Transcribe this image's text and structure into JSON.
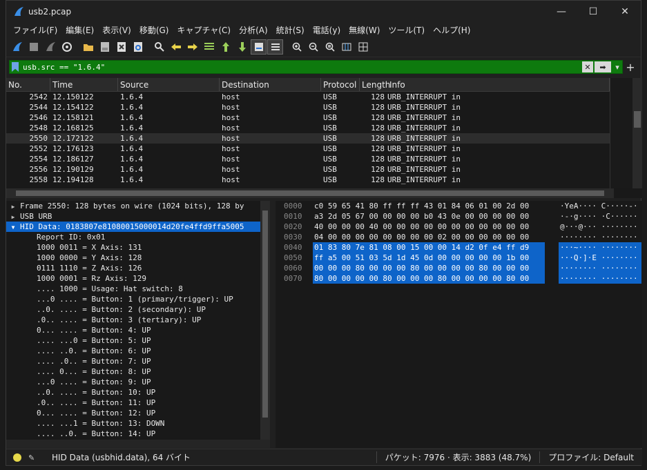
{
  "window": {
    "title": "usb2.pcap",
    "minimize": "—",
    "maximize": "☐",
    "close": "✕"
  },
  "menu": [
    "ファイル(F)",
    "編集(E)",
    "表示(V)",
    "移動(G)",
    "キャプチャ(C)",
    "分析(A)",
    "統計(S)",
    "電話(y)",
    "無線(W)",
    "ツール(T)",
    "ヘルプ(H)"
  ],
  "filter": {
    "value": "usb.src == \"1.6.4\"",
    "clear_icon": "✕",
    "apply_icon": "➡",
    "dropdown": "▾",
    "add": "+"
  },
  "columns": [
    "No.",
    "Time",
    "Source",
    "Destination",
    "Protocol",
    "Length",
    "Info"
  ],
  "packets": [
    {
      "no": "2542",
      "time": "12.150122",
      "src": "1.6.4",
      "dst": "host",
      "proto": "USB",
      "len": "128",
      "info": "URB_INTERRUPT in"
    },
    {
      "no": "2544",
      "time": "12.154122",
      "src": "1.6.4",
      "dst": "host",
      "proto": "USB",
      "len": "128",
      "info": "URB_INTERRUPT in"
    },
    {
      "no": "2546",
      "time": "12.158121",
      "src": "1.6.4",
      "dst": "host",
      "proto": "USB",
      "len": "128",
      "info": "URB_INTERRUPT in"
    },
    {
      "no": "2548",
      "time": "12.168125",
      "src": "1.6.4",
      "dst": "host",
      "proto": "USB",
      "len": "128",
      "info": "URB_INTERRUPT in"
    },
    {
      "no": "2550",
      "time": "12.172122",
      "src": "1.6.4",
      "dst": "host",
      "proto": "USB",
      "len": "128",
      "info": "URB_INTERRUPT in"
    },
    {
      "no": "2552",
      "time": "12.176123",
      "src": "1.6.4",
      "dst": "host",
      "proto": "USB",
      "len": "128",
      "info": "URB_INTERRUPT in"
    },
    {
      "no": "2554",
      "time": "12.186127",
      "src": "1.6.4",
      "dst": "host",
      "proto": "USB",
      "len": "128",
      "info": "URB_INTERRUPT in"
    },
    {
      "no": "2556",
      "time": "12.190129",
      "src": "1.6.4",
      "dst": "host",
      "proto": "USB",
      "len": "128",
      "info": "URB_INTERRUPT in"
    },
    {
      "no": "2558",
      "time": "12.194128",
      "src": "1.6.4",
      "dst": "host",
      "proto": "USB",
      "len": "128",
      "info": "URB_INTERRUPT in"
    }
  ],
  "details": [
    {
      "tw": "▶",
      "indent": 0,
      "text": "Frame 2550: 128 bytes on wire (1024 bits), 128 by"
    },
    {
      "tw": "▶",
      "indent": 0,
      "text": "USB URB"
    },
    {
      "tw": "▼",
      "indent": 0,
      "text": "HID Data: 0183807e81080015000014d20fe4ffd9ffa5005"
    },
    {
      "tw": "",
      "indent": 1,
      "text": "Report ID: 0x01"
    },
    {
      "tw": "",
      "indent": 1,
      "text": "1000 0011 = X Axis: 131"
    },
    {
      "tw": "",
      "indent": 1,
      "text": "1000 0000 = Y Axis: 128"
    },
    {
      "tw": "",
      "indent": 1,
      "text": "0111 1110 = Z Axis: 126"
    },
    {
      "tw": "",
      "indent": 1,
      "text": "1000 0001 = Rz Axis: 129"
    },
    {
      "tw": "",
      "indent": 1,
      "text": ".... 1000 = Usage: Hat switch: 8"
    },
    {
      "tw": "",
      "indent": 1,
      "text": "...0 .... = Button: 1 (primary/trigger): UP"
    },
    {
      "tw": "",
      "indent": 1,
      "text": "..0. .... = Button: 2 (secondary): UP"
    },
    {
      "tw": "",
      "indent": 1,
      "text": ".0.. .... = Button: 3 (tertiary): UP"
    },
    {
      "tw": "",
      "indent": 1,
      "text": "0... .... = Button: 4: UP"
    },
    {
      "tw": "",
      "indent": 1,
      "text": ".... ...0 = Button: 5: UP"
    },
    {
      "tw": "",
      "indent": 1,
      "text": ".... ..0. = Button: 6: UP"
    },
    {
      "tw": "",
      "indent": 1,
      "text": ".... .0.. = Button: 7: UP"
    },
    {
      "tw": "",
      "indent": 1,
      "text": ".... 0... = Button: 8: UP"
    },
    {
      "tw": "",
      "indent": 1,
      "text": "...0 .... = Button: 9: UP"
    },
    {
      "tw": "",
      "indent": 1,
      "text": "..0. .... = Button: 10: UP"
    },
    {
      "tw": "",
      "indent": 1,
      "text": ".0.. .... = Button: 11: UP"
    },
    {
      "tw": "",
      "indent": 1,
      "text": "0... .... = Button: 12: UP"
    },
    {
      "tw": "",
      "indent": 1,
      "text": ".... ...1 = Button: 13: DOWN"
    },
    {
      "tw": "",
      "indent": 1,
      "text": ".... ..0. = Button: 14: UP"
    }
  ],
  "bytes": [
    {
      "off": "0000",
      "hex": "c0 59 65 41 80 ff ff ff  43 01 84 06 01 00 2d 00",
      "ascii": "·YeA····  C·····-·"
    },
    {
      "off": "0010",
      "hex": "a3 2d 05 67 00 00 00 00  b0 43 0e 00 00 00 00 00",
      "ascii": "·-·g····  ·C······"
    },
    {
      "off": "0020",
      "hex": "40 00 00 00 40 00 00 00  00 00 00 00 00 00 00 00",
      "ascii": "@···@···  ········"
    },
    {
      "off": "0030",
      "hex": "04 00 00 00 00 00 00 00  00 02 00 00 00 00 00 00",
      "ascii": "········  ········"
    },
    {
      "off": "0040",
      "hex": "01 83 80 7e 81 08 00 15  00 00 14 d2 0f e4 ff d9",
      "ascii": "···~····  ········"
    },
    {
      "off": "0050",
      "hex": "ff a5 00 51 03 5d 1d 45  0d 00 00 00 00 00 1b 00",
      "ascii": "···Q·]·E  ········"
    },
    {
      "off": "0060",
      "hex": "00 00 00 80 00 00 00 80  00 00 00 00 80 00 00 00",
      "ascii": "········  ········"
    },
    {
      "off": "0070",
      "hex": "80 00 00 00 00 80 00 00  00 80 00 00 00 00 80 00",
      "ascii": "········  ········"
    }
  ],
  "highlight_rows": [
    "0040",
    "0050",
    "0060",
    "0070"
  ],
  "status": {
    "main": "HID Data (usbhid.data), 64 バイト",
    "packets": "パケット: 7976 · 表示: 3883 (48.7%)",
    "profile": "プロファイル: Default"
  },
  "colors": {
    "accent": "#0e64c9",
    "filter_ok": "#0e7a0e",
    "status_led": "#e6d84a"
  }
}
